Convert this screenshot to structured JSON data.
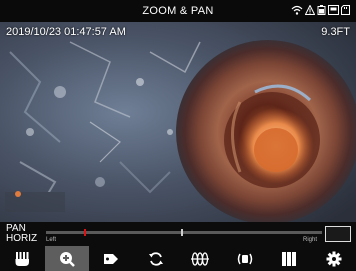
{
  "header": {
    "title": "ZOOM & PAN",
    "status_icons": [
      "wifi-icon",
      "alert-triangle-icon",
      "battery-icon",
      "storage-icon",
      "sd-card-icon"
    ]
  },
  "camera": {
    "timestamp": "2019/10/23 01:47:57 AM",
    "distance": "9.3FT"
  },
  "pan": {
    "label_line1": "PAN",
    "label_line2": "HORIZ",
    "left_label": "Left",
    "right_label": "Right",
    "marker_color": "#dd1111"
  },
  "toolbar": {
    "items": [
      {
        "icon": "grip-icon",
        "active": false
      },
      {
        "icon": "zoom-icon",
        "active": true
      },
      {
        "icon": "tag-icon",
        "active": false
      },
      {
        "icon": "rotate-icon",
        "active": false
      },
      {
        "icon": "coil-icon",
        "active": false
      },
      {
        "icon": "sonde-icon",
        "active": false
      },
      {
        "icon": "columns-icon",
        "active": false
      },
      {
        "icon": "settings-icon",
        "active": false
      }
    ]
  }
}
